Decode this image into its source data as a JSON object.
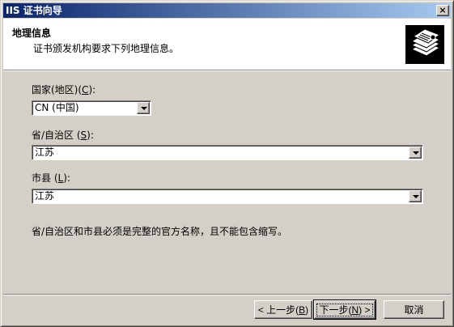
{
  "window": {
    "title": "IIS 证书向导",
    "close_label": "×"
  },
  "header": {
    "title": "地理信息",
    "description": "证书颁发机构要求下列地理信息。",
    "icon": "certificate-stack-icon"
  },
  "form": {
    "country": {
      "label_prefix": "国家(地区)(",
      "label_hotkey": "C",
      "label_suffix": "):",
      "value": "CN (中国)"
    },
    "province": {
      "label_prefix": "省/自治区 (",
      "label_hotkey": "S",
      "label_suffix": "):",
      "value": "江苏"
    },
    "city": {
      "label_prefix": "市县 (",
      "label_hotkey": "L",
      "label_suffix": "):",
      "value": "江苏"
    },
    "note": "省/自治区和市县必须是完整的官方名称，且不能包含缩写。"
  },
  "buttons": {
    "back": {
      "prefix": "< 上一步(",
      "hotkey": "B",
      "suffix": ")"
    },
    "next": {
      "prefix": "下一步(",
      "hotkey": "N",
      "suffix": ") >"
    },
    "cancel": {
      "label": "取消"
    }
  }
}
